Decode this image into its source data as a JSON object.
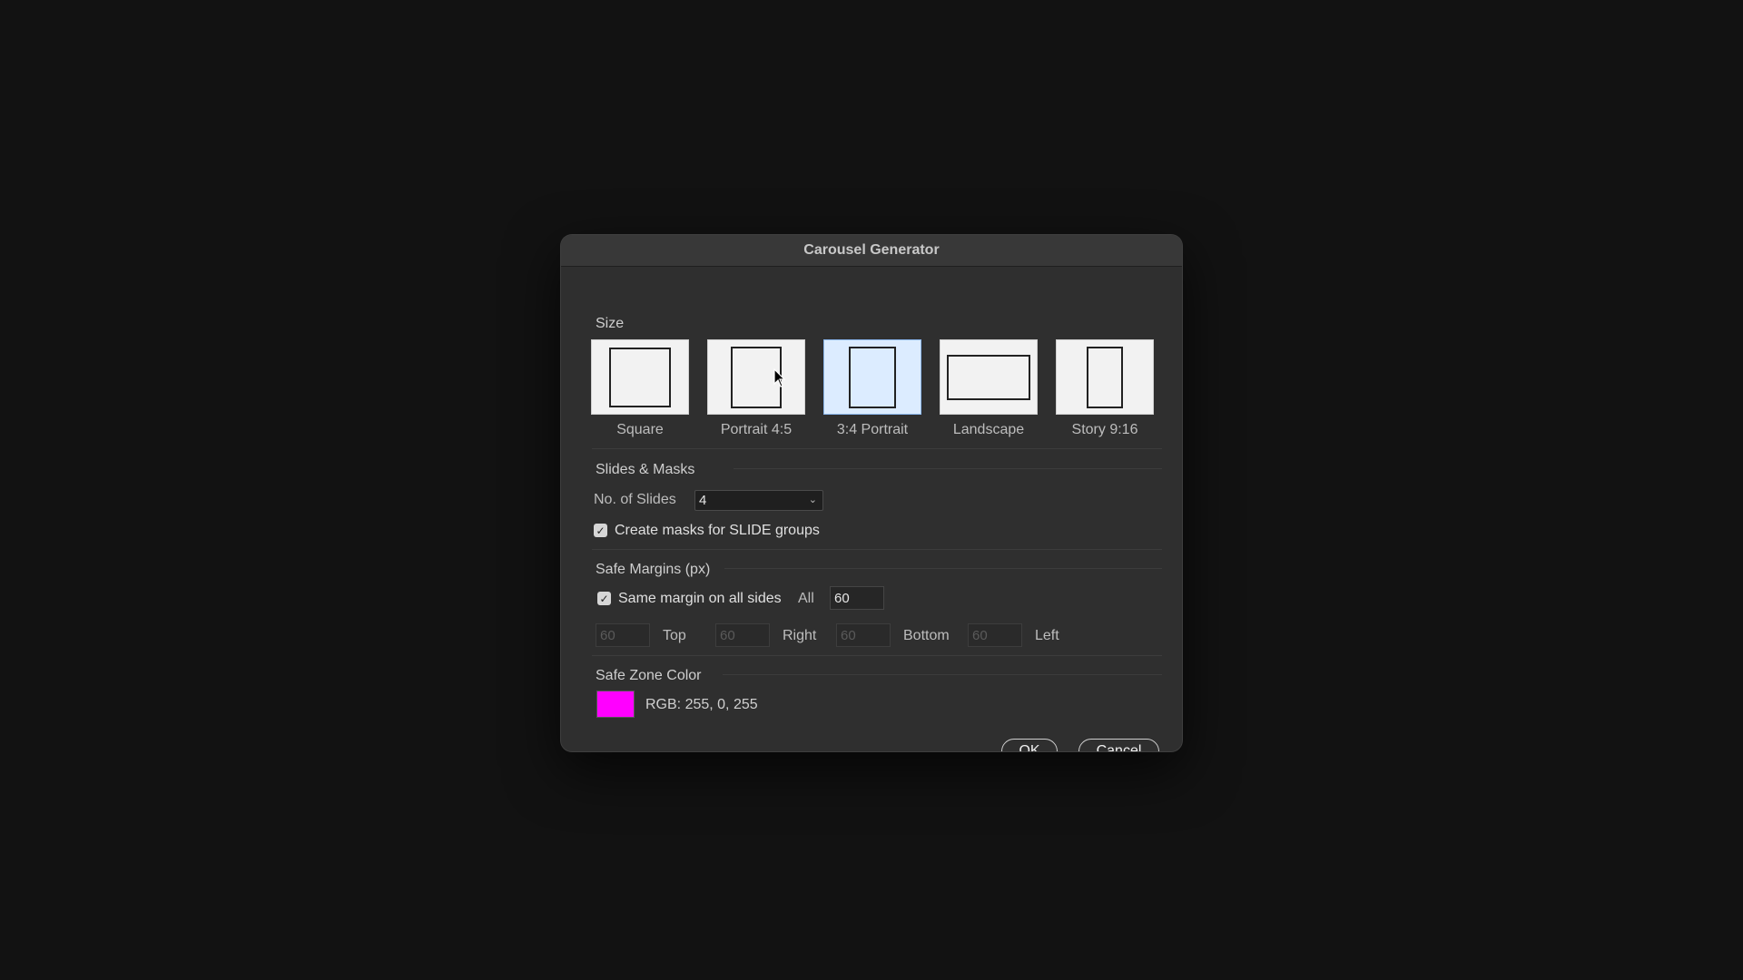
{
  "window": {
    "title": "Carousel Generator"
  },
  "size_section": {
    "label": "Size",
    "options": [
      {
        "label": "Square",
        "selected": false
      },
      {
        "label": "Portrait 4:5",
        "selected": false
      },
      {
        "label": "3:4 Portrait",
        "selected": true
      },
      {
        "label": "Landscape",
        "selected": false
      },
      {
        "label": "Story 9:16",
        "selected": false
      }
    ]
  },
  "slides_section": {
    "label": "Slides & Masks",
    "slides_label": "No. of Slides",
    "slides_value": "4",
    "masks_checked": true,
    "masks_label": "Create masks for SLIDE groups"
  },
  "margins_section": {
    "label": "Safe Margins (px)",
    "same_margin_checked": true,
    "same_margin_label": "Same margin on all sides",
    "all_label": "All",
    "all_value": "60",
    "top_value": "60",
    "top_label": "Top",
    "right_value": "60",
    "right_label": "Right",
    "bottom_value": "60",
    "bottom_label": "Bottom",
    "left_value": "60",
    "left_label": "Left"
  },
  "color_section": {
    "label": "Safe Zone Color",
    "swatch_color": "#ff00ff",
    "rgb_text": "RGB: 255, 0, 255"
  },
  "buttons": {
    "ok": "OK",
    "cancel": "Cancel"
  }
}
